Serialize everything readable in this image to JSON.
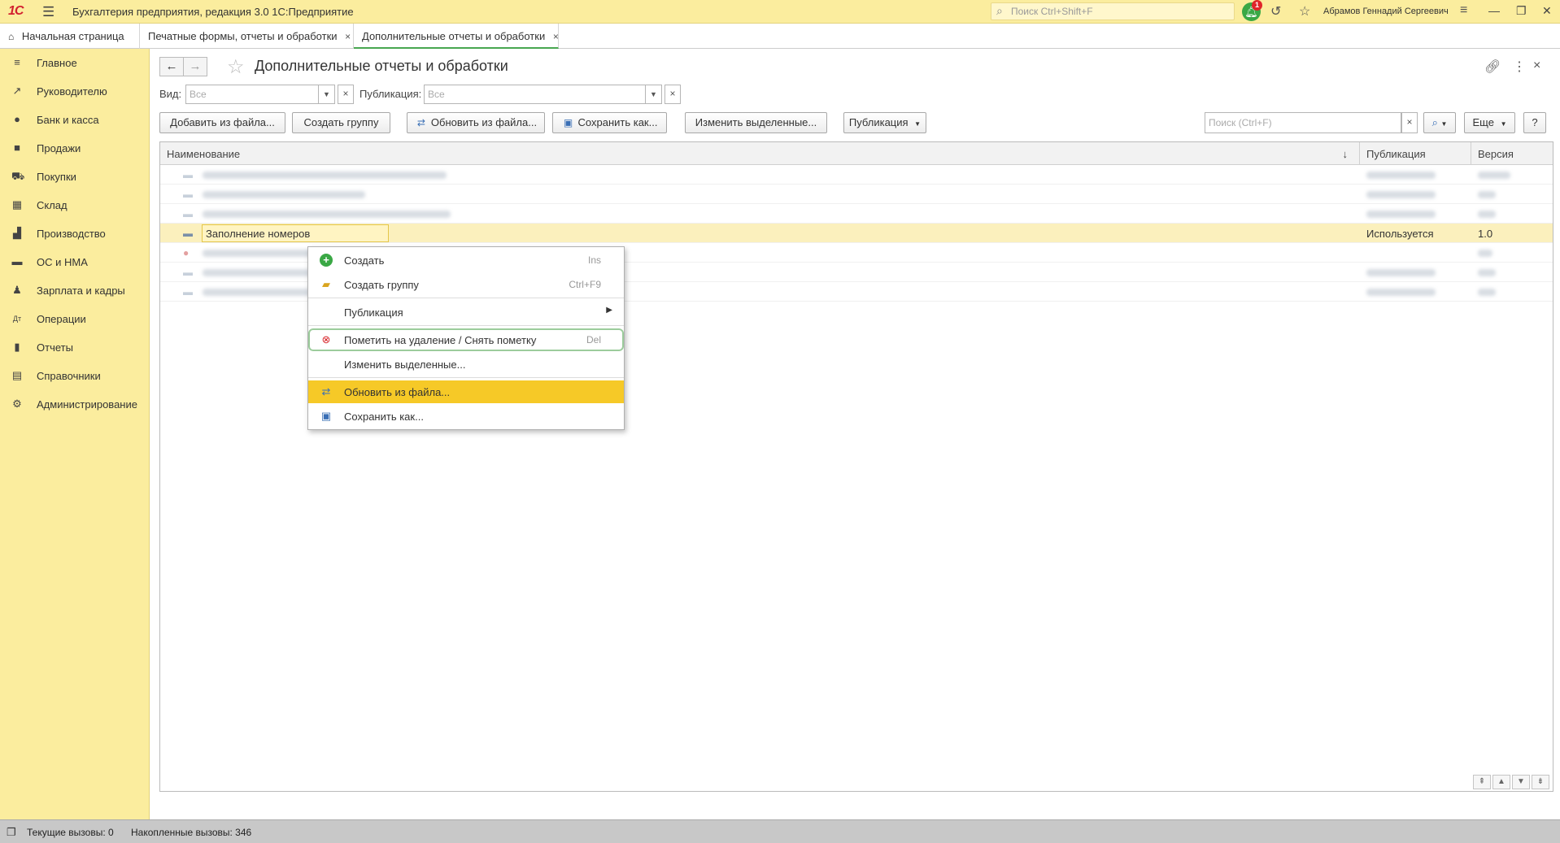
{
  "titlebar": {
    "logo": "1С",
    "app_title": "Бухгалтерия предприятия, редакция 3.0 1С:Предприятие",
    "search_placeholder": "Поиск Ctrl+Shift+F",
    "notifications_count": "1",
    "user_name": "Абрамов Геннадий Сергеевич"
  },
  "tabs": [
    {
      "label": "Начальная страница",
      "icon": "home-icon"
    },
    {
      "label": "Печатные формы, отчеты и обработки",
      "close": "×"
    },
    {
      "label": "Дополнительные отчеты и обработки",
      "close": "×",
      "active": true
    }
  ],
  "sidebar": {
    "items": [
      {
        "label": "Главное",
        "icon": "menu-lines-icon"
      },
      {
        "label": "Руководителю",
        "icon": "trend-icon"
      },
      {
        "label": "Банк и касса",
        "icon": "coin-icon"
      },
      {
        "label": "Продажи",
        "icon": "bag-icon"
      },
      {
        "label": "Покупки",
        "icon": "cart-icon"
      },
      {
        "label": "Склад",
        "icon": "grid-icon"
      },
      {
        "label": "Производство",
        "icon": "factory-icon"
      },
      {
        "label": "ОС и НМА",
        "icon": "truck-icon"
      },
      {
        "label": "Зарплата и кадры",
        "icon": "person-icon"
      },
      {
        "label": "Операции",
        "icon": "dt-kt-icon"
      },
      {
        "label": "Отчеты",
        "icon": "bar-chart-icon"
      },
      {
        "label": "Справочники",
        "icon": "books-icon"
      },
      {
        "label": "Администрирование",
        "icon": "gear-icon"
      }
    ]
  },
  "form": {
    "title": "Дополнительные отчеты и обработки",
    "filters": {
      "kind_label": "Вид:",
      "kind_placeholder": "Все",
      "publication_label": "Публикация:",
      "publication_placeholder": "Все"
    },
    "toolbar": {
      "add_from_file": "Добавить из файла...",
      "create_group": "Создать группу",
      "update_from_file": "Обновить из файла...",
      "save_as": "Сохранить как...",
      "edit_selected": "Изменить выделенные...",
      "publication": "Публикация",
      "search_placeholder": "Поиск (Ctrl+F)",
      "more": "Еще",
      "help": "?"
    },
    "table": {
      "columns": [
        "Наименование",
        "Публикация",
        "Версия"
      ],
      "sort_indicator": "↓",
      "selected_row": {
        "name": "Заполнение номеров",
        "publication": "Используется",
        "version": "1.0"
      }
    }
  },
  "context_menu": {
    "items": [
      {
        "label": "Создать",
        "shortcut": "Ins",
        "icon": "plus-circle-icon"
      },
      {
        "label": "Создать группу",
        "shortcut": "Ctrl+F9",
        "icon": "folder-add-icon"
      },
      {
        "label": "Публикация",
        "submenu": true
      },
      {
        "label": "Пометить на удаление / Снять пометку",
        "shortcut": "Del",
        "icon": "delete-mark-icon"
      },
      {
        "label": "Изменить выделенные..."
      },
      {
        "label": "Обновить из файла...",
        "icon": "update-file-icon",
        "highlighted": true
      },
      {
        "label": "Сохранить как...",
        "icon": "save-icon"
      }
    ]
  },
  "statusbar": {
    "current_calls": "Текущие вызовы: 0",
    "accumulated_calls": "Накопленные вызовы: 346"
  },
  "colors": {
    "panel_yellow": "#fbed9e",
    "highlight": "#f6c927",
    "selected_row": "#fbf0bd",
    "accent_green": "#48a650"
  }
}
